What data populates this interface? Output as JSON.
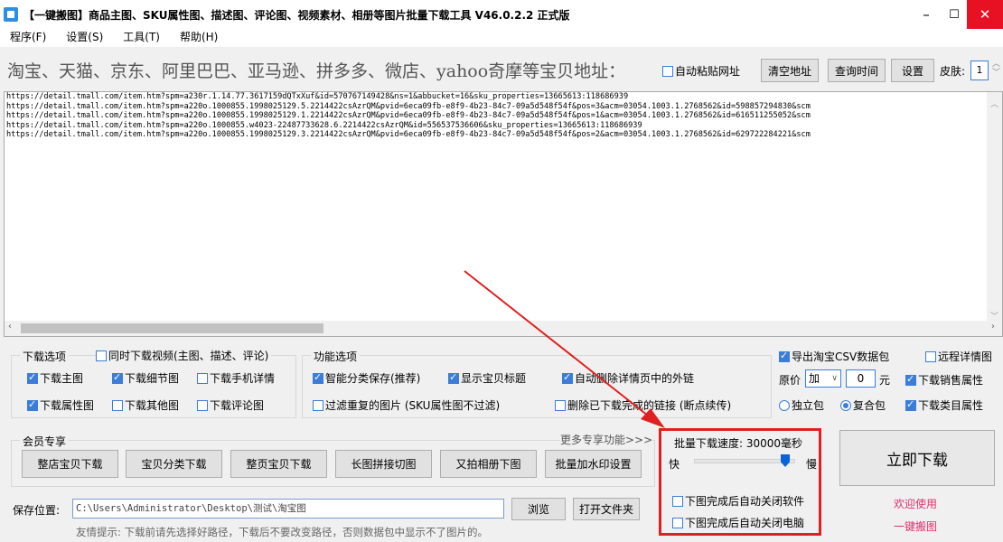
{
  "window": {
    "title": "【一键搬图】商品主图、SKU属性图、描述图、评论图、视频素材、相册等图片批量下载工具 V46.0.2.2 正式版",
    "min": "–",
    "max": "☐",
    "close": "✕"
  },
  "menu": [
    "程序(F)",
    "设置(S)",
    "工具(T)",
    "帮助(H)"
  ],
  "header": {
    "prompt": "淘宝、天猫、京东、阿里巴巴、亚马逊、拼多多、微店、yahoo奇摩等宝贝地址：",
    "auto_paste": "自动粘贴网址",
    "clear_btn": "清空地址",
    "query_time_btn": "查询时间",
    "settings_btn": "设置",
    "skin_label": "皮肤:",
    "skin_value": "1"
  },
  "urls": [
    "https://detail.tmall.com/item.htm?spm=a230r.1.14.77.3617159dQTxXuf&id=570767149428&ns=1&abbucket=16&sku_properties=13665613:118686939",
    "https://detail.tmall.com/item.htm?spm=a220o.1000855.1998025129.5.2214422csAzrQM&pvid=6eca09fb-e8f9-4b23-84c7-09a5d548f54f&pos=3&acm=03054.1003.1.2768562&id=598857294830&scm",
    "https://detail.tmall.com/item.htm?spm=a220o.1000855.1998025129.1.2214422csAzrQM&pvid=6eca09fb-e8f9-4b23-84c7-09a5d548f54f&pos=1&acm=03054.1003.1.2768562&id=616511255052&scm",
    "https://detail.tmall.com/item.htm?spm=a220o.1000855.w4023-22487733628.6.2214422csAzrQM&id=556537536606&sku_properties=13665613:118686939",
    "https://detail.tmall.com/item.htm?spm=a220o.1000855.1998025129.3.2214422csAzrQM&pvid=6eca09fb-e8f9-4b23-84c7-09a5d548f54f&pos=2&acm=03054.1003.1.2768562&id=629722284221&scm"
  ],
  "download_options": {
    "title": "下载选项",
    "video": "同时下载视频(主图、描述、评论)",
    "main_img": "下载主图",
    "detail_img": "下载细节图",
    "mobile_detail": "下载手机详情",
    "attr_img": "下载属性图",
    "other_img": "下载其他图",
    "review_img": "下载评论图"
  },
  "function_options": {
    "title": "功能选项",
    "smart_save": "智能分类保存(推荐)",
    "show_title": "显示宝贝标题",
    "auto_delete_links": "自动删除详情页中的外链",
    "filter_dup": "过滤重复的图片 (SKU属性图不过滤)",
    "delete_downloaded": "删除已下载完成的链接 (断点续传)"
  },
  "right_options": {
    "export_csv": "导出淘宝CSV数据包",
    "remote_detail": "远程详情图",
    "price_label": "原价",
    "price_op": "加",
    "price_value": "0",
    "price_unit": "元",
    "sales_attr": "下载销售属性",
    "single_pack": "独立包",
    "combo_pack": "复合包",
    "category_attr": "下载类目属性"
  },
  "member": {
    "title": "会员专享",
    "more": "更多专享功能>>>",
    "buttons": [
      "整店宝贝下载",
      "宝贝分类下载",
      "整页宝贝下载",
      "长图拼接切图",
      "又拍相册下图",
      "批量加水印设置"
    ]
  },
  "speed": {
    "title": "批量下载速度: 30000毫秒",
    "fast": "快",
    "slow": "慢",
    "auto_close_app": "下图完成后自动关闭软件",
    "auto_shutdown": "下图完成后自动关闭电脑"
  },
  "start_btn": "立即下载",
  "welcome": [
    "欢迎使用",
    "一键搬图"
  ],
  "save": {
    "label": "保存位置:",
    "path": "C:\\Users\\Administrator\\Desktop\\测试\\淘宝图",
    "browse": "浏览",
    "open_folder": "打开文件夹",
    "tip": "友情提示: 下载前请先选择好路径，下载后不要改变路径，否则数据包中显示不了图片的。"
  },
  "colors": {
    "checkbox": "#3b7dd8",
    "highlight": "#e02020",
    "welcome": "#e0306a",
    "slider": "#0a64d8"
  }
}
